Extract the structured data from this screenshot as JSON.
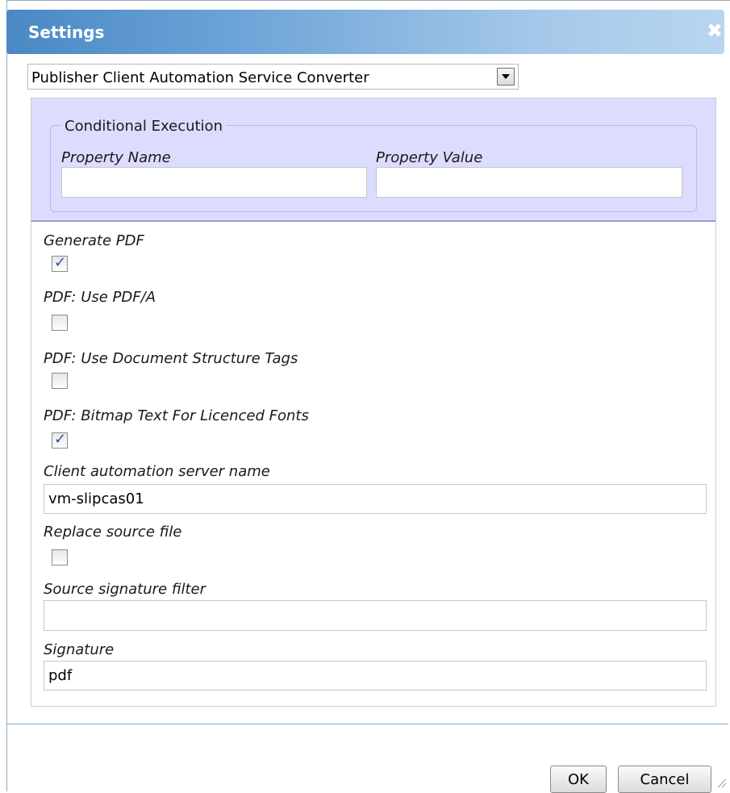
{
  "dialog": {
    "title": "Settings",
    "close_glyph": "✖"
  },
  "converter_select": {
    "value": "Publisher Client Automation Service Converter"
  },
  "conditional": {
    "legend": "Conditional Execution",
    "property_name_label": "Property Name",
    "property_name_value": "",
    "property_value_label": "Property Value",
    "property_value_value": ""
  },
  "fields": {
    "generate_pdf": {
      "label": "Generate PDF",
      "checked": true
    },
    "pdf_a": {
      "label": "PDF: Use PDF/A",
      "checked": false
    },
    "doc_structure": {
      "label": "PDF: Use Document Structure Tags",
      "checked": false
    },
    "bitmap_text": {
      "label": "PDF: Bitmap Text For Licenced Fonts",
      "checked": true
    },
    "server_name": {
      "label": "Client automation server name",
      "value": "vm-slipcas01"
    },
    "replace_source": {
      "label": "Replace source file",
      "checked": false
    },
    "source_filter": {
      "label": "Source signature filter",
      "value": ""
    },
    "signature": {
      "label": "Signature",
      "value": "pdf"
    }
  },
  "buttons": {
    "ok": "OK",
    "cancel": "Cancel"
  },
  "colors": {
    "titlebar_start": "#4a88c4",
    "titlebar_end": "#b9d5ef",
    "conditional_bg": "#dcdcff",
    "separator": "#7aa6cf"
  }
}
